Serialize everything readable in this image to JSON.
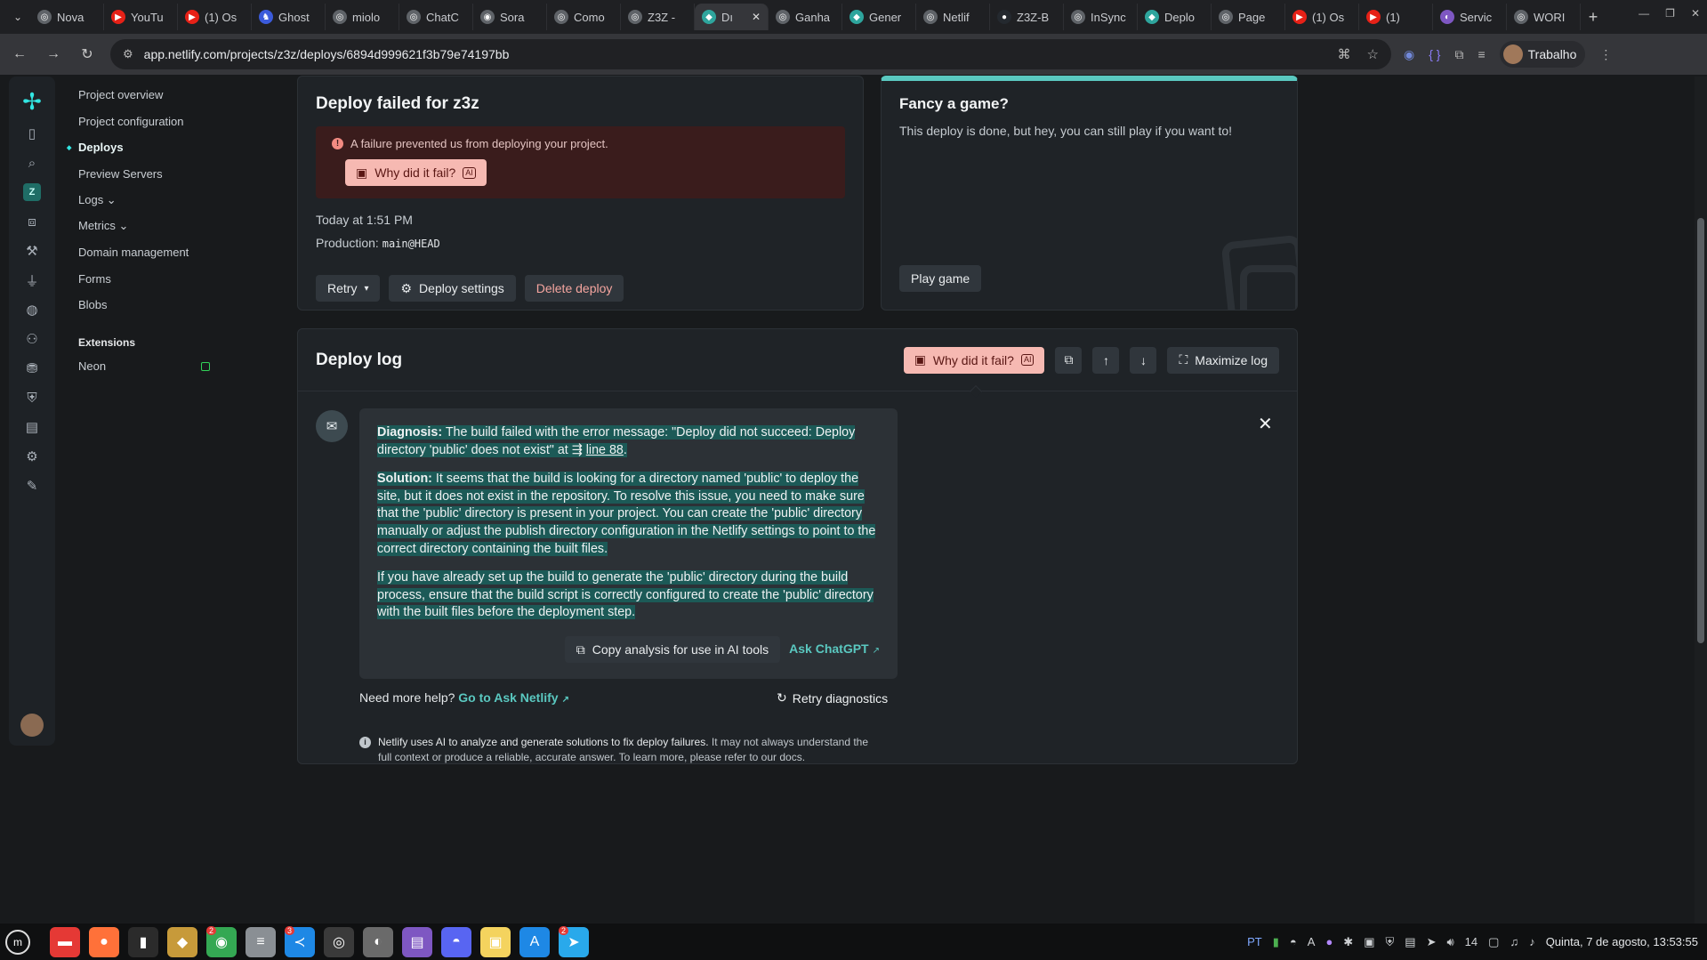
{
  "browser": {
    "tabs": [
      {
        "label": "Nova",
        "color": "#5f6368",
        "glyph": "◎"
      },
      {
        "label": "YouTu",
        "color": "#e62117",
        "glyph": "▶"
      },
      {
        "label": "(1) Os",
        "color": "#e62117",
        "glyph": "▶"
      },
      {
        "label": "Ghost",
        "color": "#3b5bdb",
        "glyph": "♞"
      },
      {
        "label": "miolo",
        "color": "#5f6368",
        "glyph": "◎"
      },
      {
        "label": "ChatC",
        "color": "#5f6368",
        "glyph": "◎"
      },
      {
        "label": "Sora",
        "color": "#5f6368",
        "glyph": "◉"
      },
      {
        "label": "Como",
        "color": "#5f6368",
        "glyph": "◎"
      },
      {
        "label": "Z3Z -",
        "color": "#5f6368",
        "glyph": "◎"
      },
      {
        "label": "Dı",
        "color": "#2ea59d",
        "glyph": "◆"
      },
      {
        "label": "Ganha",
        "color": "#5f6368",
        "glyph": "◎"
      },
      {
        "label": "Gener",
        "color": "#2ea59d",
        "glyph": "◆"
      },
      {
        "label": "Netlif",
        "color": "#5f6368",
        "glyph": "◎"
      },
      {
        "label": "Z3Z-B",
        "color": "#24292f",
        "glyph": "●"
      },
      {
        "label": "InSync",
        "color": "#5f6368",
        "glyph": "◎"
      },
      {
        "label": "Deplo",
        "color": "#2ea59d",
        "glyph": "◆"
      },
      {
        "label": "Page",
        "color": "#5f6368",
        "glyph": "◎"
      },
      {
        "label": "(1) Os",
        "color": "#e62117",
        "glyph": "▶"
      },
      {
        "label": "(1)",
        "color": "#e62117",
        "glyph": "▶"
      },
      {
        "label": "Servic",
        "color": "#7e57c2",
        "glyph": "◐"
      },
      {
        "label": "WORI",
        "color": "#5f6368",
        "glyph": "◎"
      }
    ],
    "active_tab_index": 9,
    "url": "app.netlify.com/projects/z3z/deploys/6894d999621f3b79e74197bb",
    "profile_name": "Trabalho"
  },
  "rail": {
    "team_initial": "Z"
  },
  "project_nav": {
    "items": [
      {
        "label": "Project overview",
        "active": false
      },
      {
        "label": "Project configuration",
        "active": false
      },
      {
        "label": "Deploys",
        "active": true
      },
      {
        "label": "Preview Servers",
        "active": false
      },
      {
        "label": "Logs ⌄",
        "active": false
      },
      {
        "label": "Metrics ⌄",
        "active": false
      },
      {
        "label": "Domain management",
        "active": false
      },
      {
        "label": "Forms",
        "active": false
      },
      {
        "label": "Blobs",
        "active": false
      }
    ],
    "extensions_heading": "Extensions",
    "extensions": [
      {
        "label": "Neon"
      }
    ]
  },
  "deploy_card": {
    "title": "Deploy failed for z3z",
    "alert_message": "A failure prevented us from deploying your project.",
    "why_label": "Why did it fail?",
    "ai_badge": "AI",
    "time": "Today at 1:51 PM",
    "production_label": "Production:",
    "branch": "main@HEAD",
    "retry_label": "Retry",
    "settings_label": "Deploy settings",
    "delete_label": "Delete deploy"
  },
  "game_card": {
    "title": "Fancy a game?",
    "text": "This deploy is done, but hey, you can still play if you want to!",
    "play_label": "Play game"
  },
  "deploy_log": {
    "title": "Deploy log",
    "why_label": "Why did it fail?",
    "ai_badge": "AI",
    "maximize_label": "Maximize log",
    "diagnosis_label": "Diagnosis:",
    "diagnosis_text": "The build failed with the error message: \"Deploy did not succeed: Deploy directory 'public' does not exist\" at",
    "line_link": "line 88",
    "solution_label": "Solution:",
    "solution_text": "It seems that the build is looking for a directory named 'public' to deploy the site, but it does not exist in the repository. To resolve this issue, you need to make sure that the 'public' directory is present in your project. You can create the 'public' directory manually or adjust the publish directory configuration in the Netlify settings to point to the correct directory containing the built files.",
    "extra_text": "If you have already set up the build to generate the 'public' directory during the build process, ensure that the build script is correctly configured to create the 'public' directory with the built files before the deployment step.",
    "copy_label": "Copy analysis for use in AI tools",
    "chatgpt_label": "Ask ChatGPT",
    "need_help_text": "Need more help?",
    "ask_netlify_label": "Go to Ask Netlify",
    "retry_diag_label": "Retry diagnostics",
    "notice_lead": "Netlify uses AI to analyze and generate solutions to fix deploy failures.",
    "notice_rest": "It may not always understand the full context or produce a reliable, accurate answer. To learn more, please refer to our docs."
  },
  "taskbar": {
    "apps": [
      {
        "name": "files-icon",
        "color": "#e53935",
        "glyph": "▬"
      },
      {
        "name": "firefox-icon",
        "color": "#ff7139",
        "glyph": "●"
      },
      {
        "name": "terminal-icon",
        "color": "#2b2b2b",
        "glyph": "▮"
      },
      {
        "name": "gimp-icon",
        "color": "#c79a3a",
        "glyph": "◆"
      },
      {
        "name": "chrome-icon",
        "color": "#34a853",
        "glyph": "◉",
        "badge": "2"
      },
      {
        "name": "mixer-icon",
        "color": "#8a8f94",
        "glyph": "≡"
      },
      {
        "name": "vscode-icon",
        "color": "#1e88e5",
        "glyph": "≺",
        "badge": "3"
      },
      {
        "name": "obs-icon",
        "color": "#3a3a3a",
        "glyph": "◎"
      },
      {
        "name": "inkscape-icon",
        "color": "#6a6a6a",
        "glyph": "◐"
      },
      {
        "name": "notes-icon",
        "color": "#7e57c2",
        "glyph": "▤"
      },
      {
        "name": "discord-icon",
        "color": "#5865f2",
        "glyph": "◓"
      },
      {
        "name": "sticky-icon",
        "color": "#f4d35e",
        "glyph": "▣"
      },
      {
        "name": "fonts-icon",
        "color": "#1e88e5",
        "glyph": "A"
      },
      {
        "name": "telegram-icon",
        "color": "#29a9eb",
        "glyph": "➤",
        "badge": "2"
      }
    ],
    "lang": "PT",
    "volume_level": "14",
    "clock": "Quinta, 7 de agosto, 13:53:55"
  }
}
